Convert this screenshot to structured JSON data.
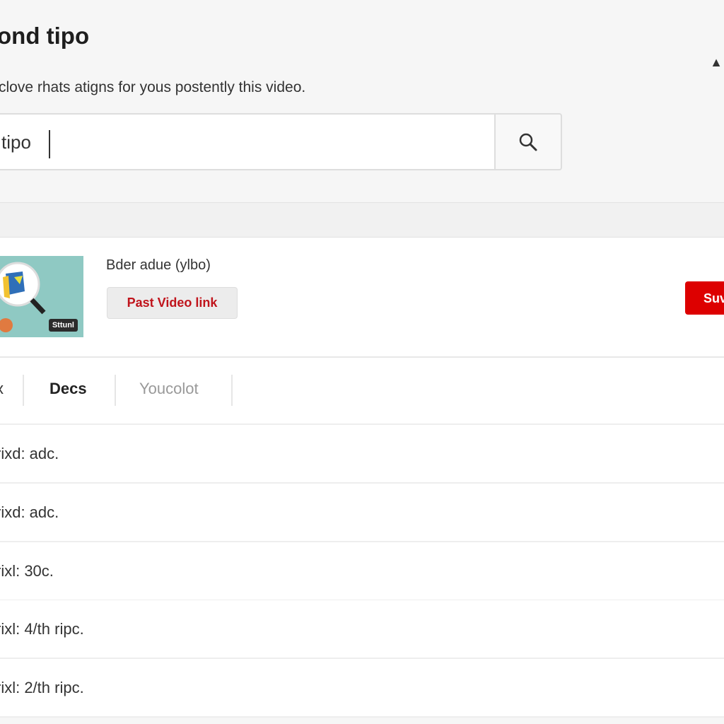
{
  "header": {
    "title": "ond tipo",
    "subtitle": "clove rhats atigns for yous postently this video."
  },
  "search": {
    "value": "tipo",
    "icon": "search-icon"
  },
  "video": {
    "thumbnail_label": "Sttunl",
    "title": "Bder adue (ylbo)",
    "paste_button": "Past Video link",
    "submit_button": "Suv",
    "accent": "#dd0000"
  },
  "tabs": [
    {
      "label": "x"
    },
    {
      "label": "Decs"
    },
    {
      "label": "Youcolot"
    }
  ],
  "rows": [
    {
      "text": "rixd: adc."
    },
    {
      "text": "rixd: adc."
    },
    {
      "text": "rixl: 30c."
    },
    {
      "text": "rixl: 4/th ripc."
    },
    {
      "text": "rixl: 2/th ripc."
    }
  ]
}
